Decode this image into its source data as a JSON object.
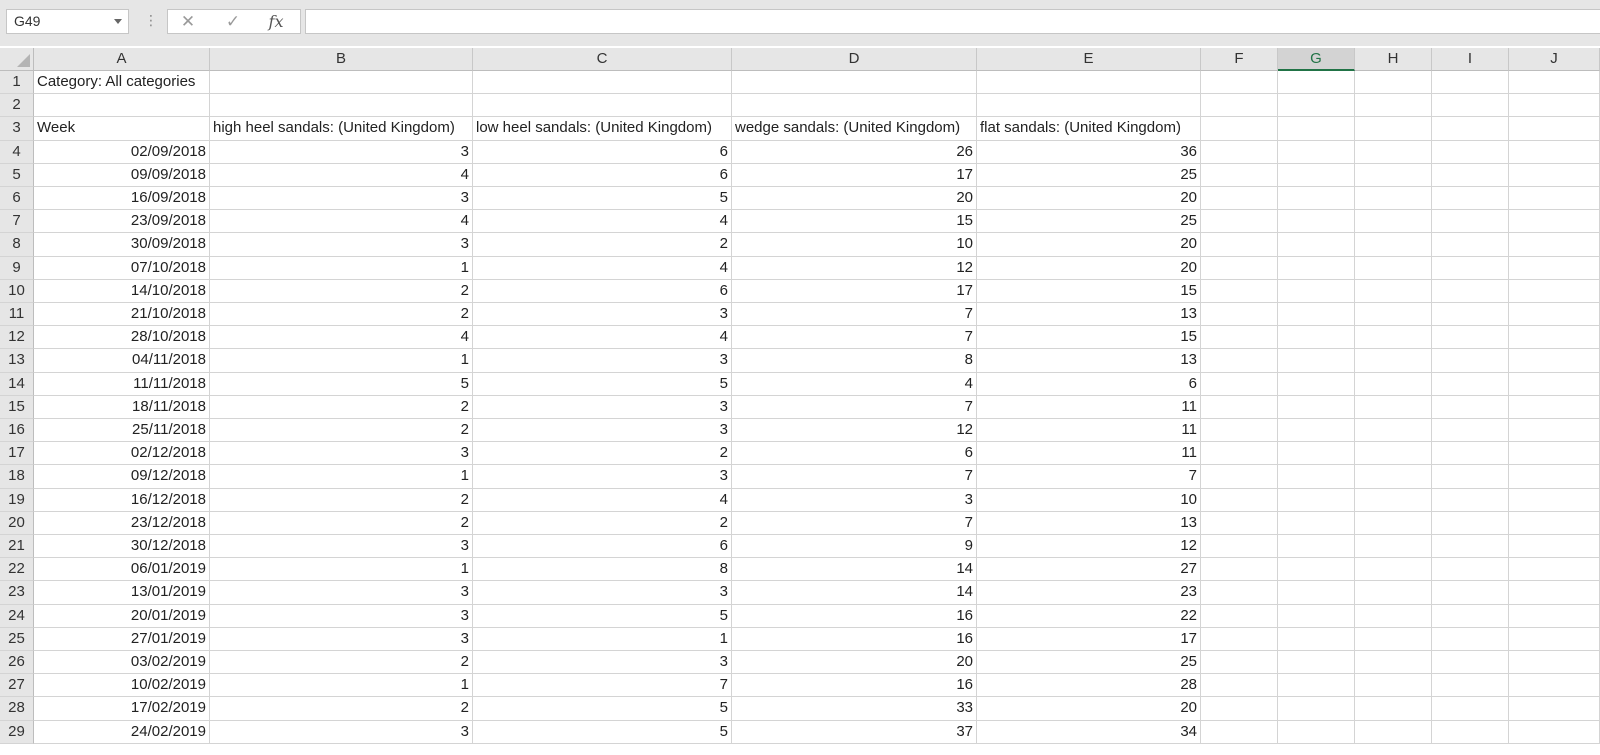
{
  "formula_bar": {
    "name_box": "G49",
    "dots": "⋮",
    "cancel_icon": "✕",
    "enter_icon": "✓",
    "fx_label": "fx",
    "formula": ""
  },
  "columns": [
    "A",
    "B",
    "C",
    "D",
    "E",
    "F",
    "G",
    "H",
    "I",
    "J"
  ],
  "selected_column": "G",
  "rows": [
    {
      "n": "1",
      "a": "Category: All categories",
      "b": "",
      "c": "",
      "d": "",
      "e": ""
    },
    {
      "n": "2",
      "a": "",
      "b": "",
      "c": "",
      "d": "",
      "e": ""
    },
    {
      "n": "3",
      "a": "Week",
      "b": "high heel sandals: (United Kingdom)",
      "c": "low heel sandals: (United Kingdom)",
      "d": "wedge sandals: (United Kingdom)",
      "e": "flat sandals: (United Kingdom)"
    },
    {
      "n": "4",
      "a": "02/09/2018",
      "b": "3",
      "c": "6",
      "d": "26",
      "e": "36"
    },
    {
      "n": "5",
      "a": "09/09/2018",
      "b": "4",
      "c": "6",
      "d": "17",
      "e": "25"
    },
    {
      "n": "6",
      "a": "16/09/2018",
      "b": "3",
      "c": "5",
      "d": "20",
      "e": "20"
    },
    {
      "n": "7",
      "a": "23/09/2018",
      "b": "4",
      "c": "4",
      "d": "15",
      "e": "25"
    },
    {
      "n": "8",
      "a": "30/09/2018",
      "b": "3",
      "c": "2",
      "d": "10",
      "e": "20"
    },
    {
      "n": "9",
      "a": "07/10/2018",
      "b": "1",
      "c": "4",
      "d": "12",
      "e": "20"
    },
    {
      "n": "10",
      "a": "14/10/2018",
      "b": "2",
      "c": "6",
      "d": "17",
      "e": "15"
    },
    {
      "n": "11",
      "a": "21/10/2018",
      "b": "2",
      "c": "3",
      "d": "7",
      "e": "13"
    },
    {
      "n": "12",
      "a": "28/10/2018",
      "b": "4",
      "c": "4",
      "d": "7",
      "e": "15"
    },
    {
      "n": "13",
      "a": "04/11/2018",
      "b": "1",
      "c": "3",
      "d": "8",
      "e": "13"
    },
    {
      "n": "14",
      "a": "11/11/2018",
      "b": "5",
      "c": "5",
      "d": "4",
      "e": "6"
    },
    {
      "n": "15",
      "a": "18/11/2018",
      "b": "2",
      "c": "3",
      "d": "7",
      "e": "11"
    },
    {
      "n": "16",
      "a": "25/11/2018",
      "b": "2",
      "c": "3",
      "d": "12",
      "e": "11"
    },
    {
      "n": "17",
      "a": "02/12/2018",
      "b": "3",
      "c": "2",
      "d": "6",
      "e": "11"
    },
    {
      "n": "18",
      "a": "09/12/2018",
      "b": "1",
      "c": "3",
      "d": "7",
      "e": "7"
    },
    {
      "n": "19",
      "a": "16/12/2018",
      "b": "2",
      "c": "4",
      "d": "3",
      "e": "10"
    },
    {
      "n": "20",
      "a": "23/12/2018",
      "b": "2",
      "c": "2",
      "d": "7",
      "e": "13"
    },
    {
      "n": "21",
      "a": "30/12/2018",
      "b": "3",
      "c": "6",
      "d": "9",
      "e": "12"
    },
    {
      "n": "22",
      "a": "06/01/2019",
      "b": "1",
      "c": "8",
      "d": "14",
      "e": "27"
    },
    {
      "n": "23",
      "a": "13/01/2019",
      "b": "3",
      "c": "3",
      "d": "14",
      "e": "23"
    },
    {
      "n": "24",
      "a": "20/01/2019",
      "b": "3",
      "c": "5",
      "d": "16",
      "e": "22"
    },
    {
      "n": "25",
      "a": "27/01/2019",
      "b": "3",
      "c": "1",
      "d": "16",
      "e": "17"
    },
    {
      "n": "26",
      "a": "03/02/2019",
      "b": "2",
      "c": "3",
      "d": "20",
      "e": "25"
    },
    {
      "n": "27",
      "a": "10/02/2019",
      "b": "1",
      "c": "7",
      "d": "16",
      "e": "28"
    },
    {
      "n": "28",
      "a": "17/02/2019",
      "b": "2",
      "c": "5",
      "d": "33",
      "e": "20"
    },
    {
      "n": "29",
      "a": "24/02/2019",
      "b": "3",
      "c": "5",
      "d": "37",
      "e": "34"
    }
  ]
}
